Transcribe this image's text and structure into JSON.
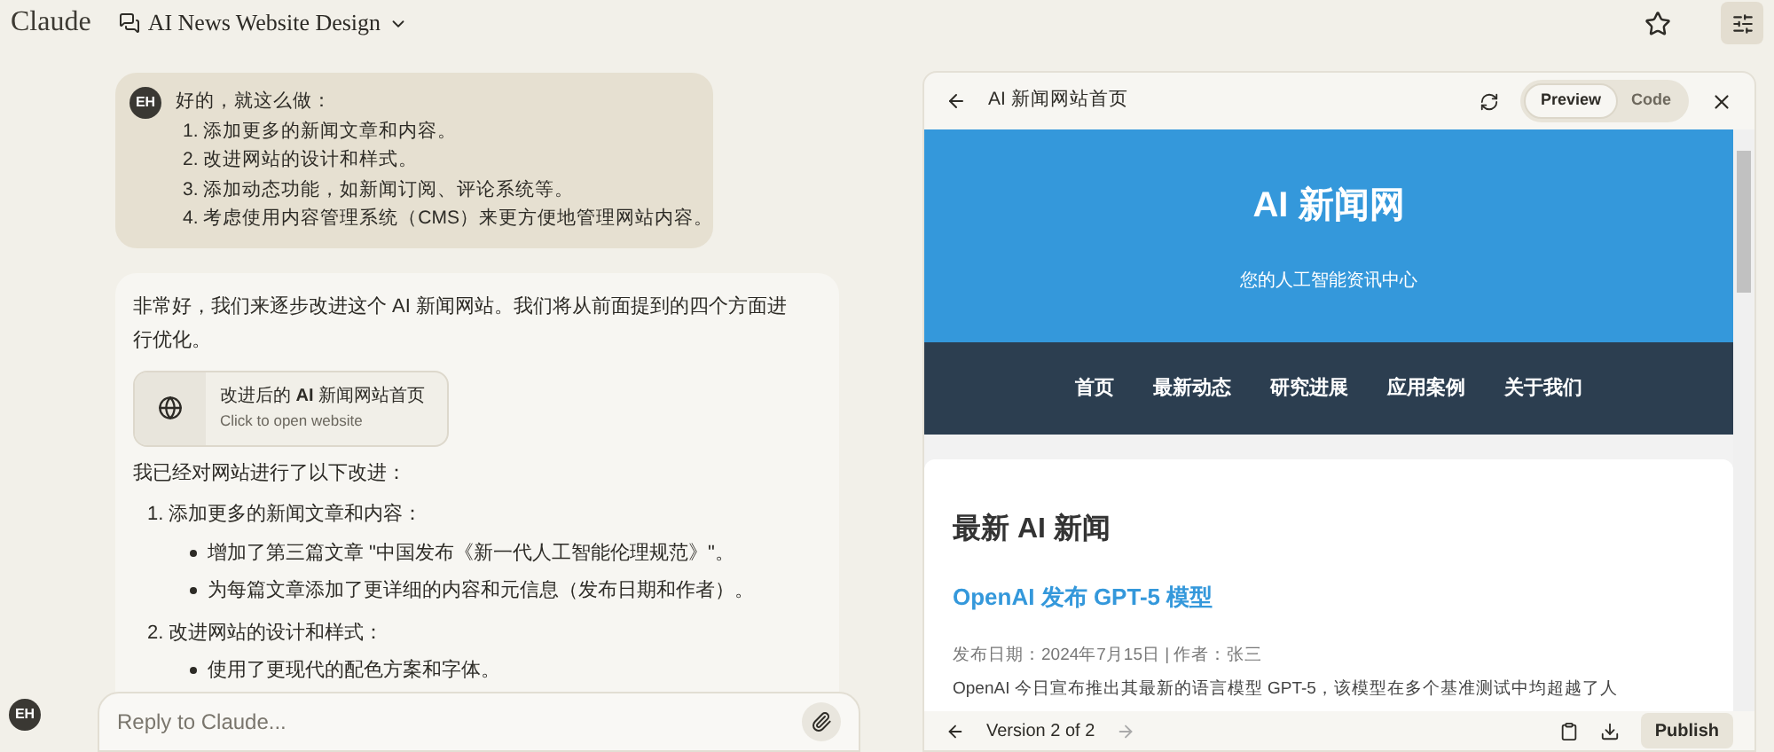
{
  "app_name": "Claude",
  "chat_title": "AI News Website Design",
  "user_message": {
    "avatar": "EH",
    "lines": [
      "好的，就这么做：",
      "1. 添加更多的新闻文章和内容。",
      "2. 改进网站的设计和样式。",
      "3. 添加动态功能，如新闻订阅、评论系统等。",
      "4. 考虑使用内容管理系统（CMS）来更方便地管理网站内容。"
    ]
  },
  "assistant_message": {
    "intro": "非常好，我们来逐步改进这个 AI 新闻网站。我们将从前面提到的四个方面进行优化。",
    "artifact": {
      "title": "改进后的 **AI** 新闻网站首页",
      "subtitle": "Click to open website"
    },
    "summary": "我已经对网站进行了以下改进：",
    "items": [
      {
        "title": "1. 添加更多的新闻文章和内容：",
        "bullets": [
          "增加了第三篇文章 \"中国发布《新一代人工智能伦理规范》\"。",
          "为每篇文章添加了更详细的内容和元信息（发布日期和作者）。"
        ]
      },
      {
        "title": "2. 改进网站的设计和样式：",
        "bullets": [
          "使用了更现代的配色方案和字体。"
        ]
      }
    ]
  },
  "reply": {
    "placeholder": "Reply to Claude..."
  },
  "bottom_avatar": "EH",
  "preview": {
    "title": "AI 新闻网站首页",
    "tabs": [
      {
        "label": "Preview",
        "selected": true
      },
      {
        "label": "Code",
        "selected": false
      }
    ],
    "site": {
      "title": "AI 新闻网",
      "tagline": "您的人工智能资讯中心",
      "nav": [
        "首页",
        "最新动态",
        "研究进展",
        "应用案例",
        "关于我们"
      ],
      "section_title": "最新 AI 新闻",
      "article_title": "OpenAI 发布 GPT-5 模型",
      "meta": "发布日期：2024年7月15日 | 作者：张三",
      "body": "OpenAI 今日宣布推出其最新的语言模型 GPT-5，该模型在多个基准测试中均超越了人"
    },
    "version": "Version 2 of 2",
    "publish": "Publish"
  }
}
